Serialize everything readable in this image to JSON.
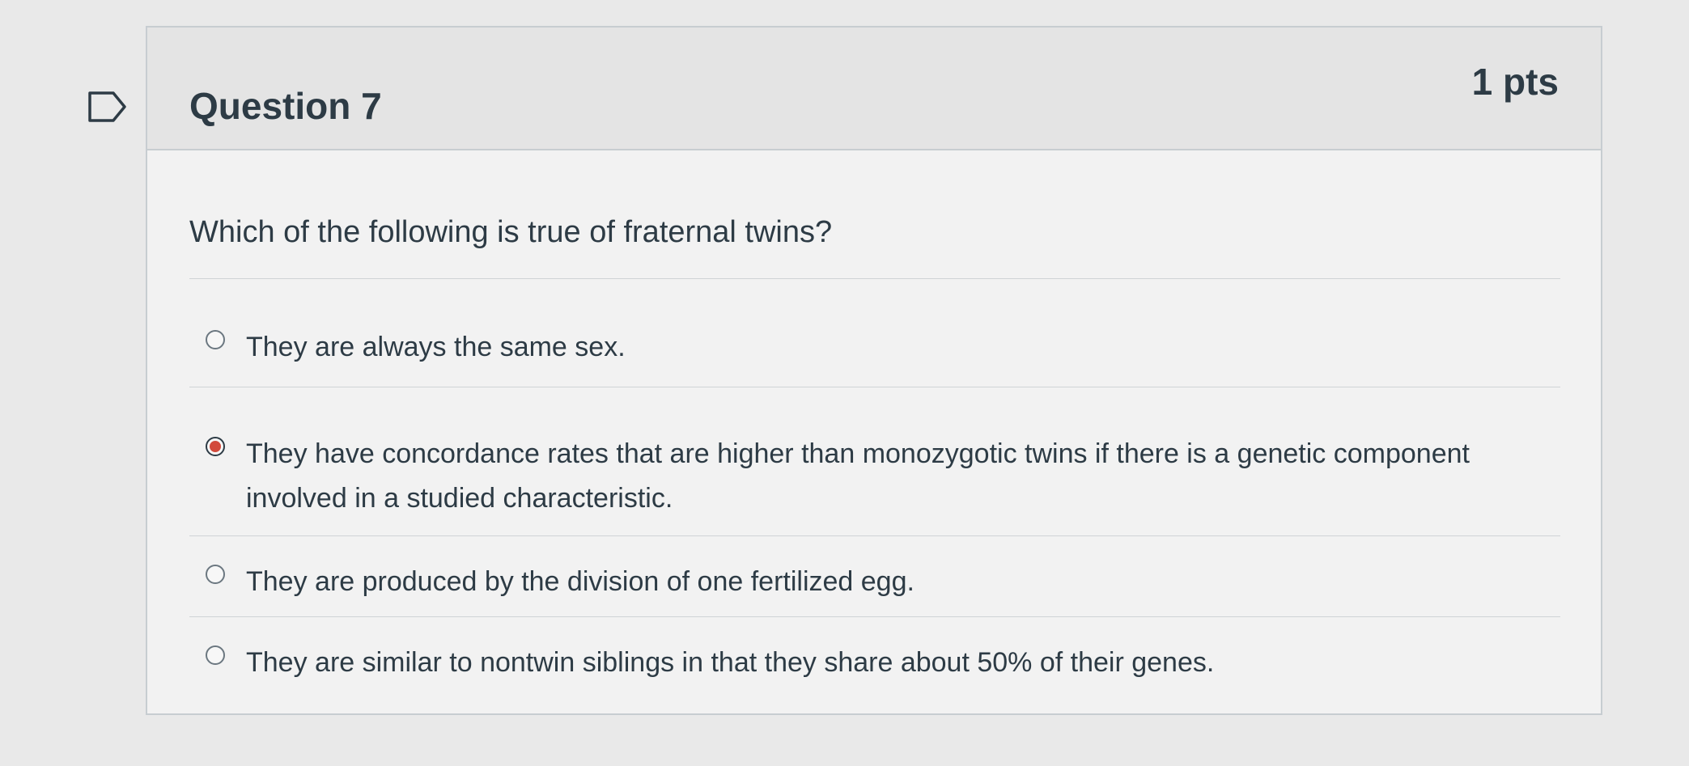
{
  "question": {
    "title": "Question 7",
    "points": "1 pts",
    "text": "Which of the following is true of fraternal twins?",
    "flag_icon": "bookmark-flag-icon"
  },
  "answers": [
    {
      "label": "They are always the same sex.",
      "selected": false
    },
    {
      "label": "They have concordance rates that are higher than monozygotic twins if there is a genetic component involved in a studied characteristic.",
      "selected": true
    },
    {
      "label": "They are produced by the division of one fertilized egg.",
      "selected": false
    },
    {
      "label": "They are similar to nontwin siblings in that they share about 50% of their genes.",
      "selected": false
    }
  ],
  "colors": {
    "selected_radio": "#d24a3c",
    "text": "#2d3b45",
    "border": "#c7cdd1"
  }
}
